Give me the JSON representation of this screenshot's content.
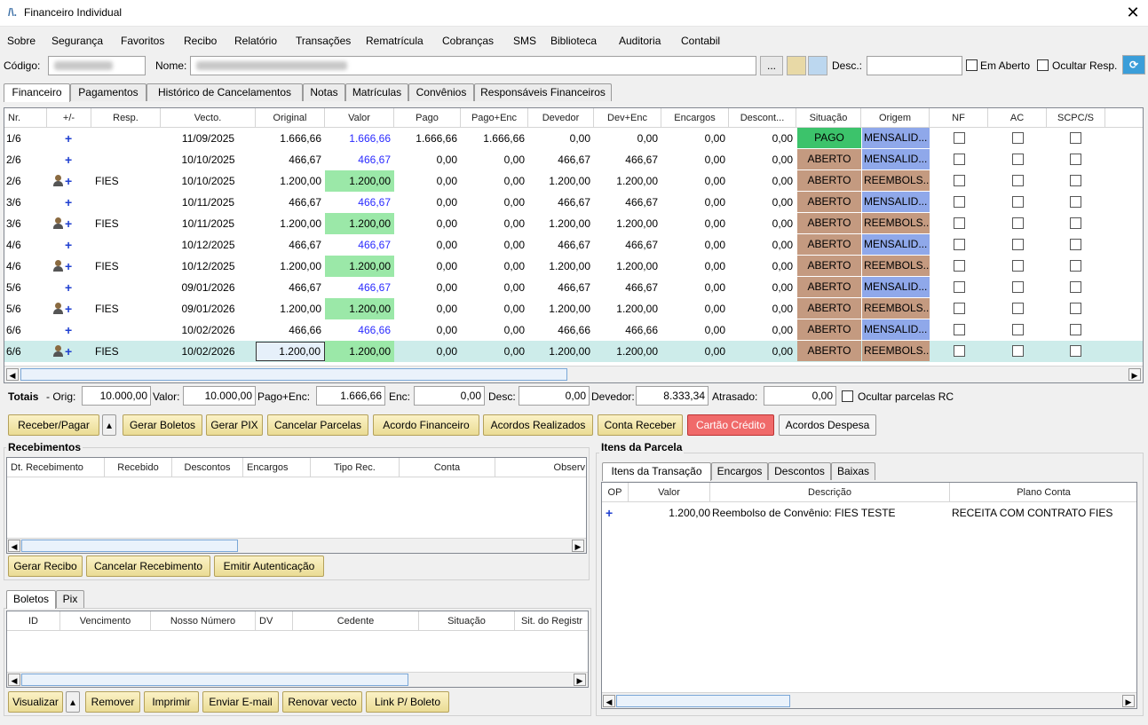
{
  "window": {
    "title": "Financeiro Individual",
    "close": "✕"
  },
  "menu": [
    "Sobre",
    "Segurança",
    "Favoritos",
    "Recibo",
    "Relatório",
    "Transações",
    "Rematrícula",
    "Cobranças",
    "SMS",
    "Biblioteca",
    "Auditoria",
    "Contabil"
  ],
  "filter": {
    "codigo_label": "Código:",
    "nome_label": "Nome:",
    "desc_label": "Desc.:",
    "em_aberto": "Em Aberto",
    "ocultar_resp": "Ocultar Resp.",
    "dots": "..."
  },
  "tabs": [
    "Financeiro",
    "Pagamentos",
    "Histórico de Cancelamentos",
    "Notas",
    "Matrículas",
    "Convênios",
    "Responsáveis Financeiros"
  ],
  "grid": {
    "headers": [
      "Nr.",
      "+/-",
      "Resp.",
      "Vecto.",
      "Original",
      "Valor",
      "Pago",
      "Pago+Enc",
      "Devedor",
      "Dev+Enc",
      "Encargos",
      "Descont...",
      "Situação",
      "Origem",
      "NF",
      "AC",
      "SCPC/S"
    ],
    "rows": [
      {
        "nr": "1/6",
        "resp": "",
        "person": false,
        "vecto": "11/09/2025",
        "original": "1.666,66",
        "valor": "1.666,66",
        "pago": "1.666,66",
        "pagoenc": "1.666,66",
        "devedor": "0,00",
        "devenc": "0,00",
        "encargos": "0,00",
        "desc": "0,00",
        "situacao": "PAGO",
        "origem": "MENSALID..."
      },
      {
        "nr": "2/6",
        "resp": "",
        "person": false,
        "vecto": "10/10/2025",
        "original": "466,67",
        "valor": "466,67",
        "pago": "0,00",
        "pagoenc": "0,00",
        "devedor": "466,67",
        "devenc": "466,67",
        "encargos": "0,00",
        "desc": "0,00",
        "situacao": "ABERTO",
        "origem": "MENSALID..."
      },
      {
        "nr": "2/6",
        "resp": "FIES",
        "person": true,
        "vecto": "10/10/2025",
        "original": "1.200,00",
        "valor": "1.200,00",
        "pago": "0,00",
        "pagoenc": "0,00",
        "devedor": "1.200,00",
        "devenc": "1.200,00",
        "encargos": "0,00",
        "desc": "0,00",
        "situacao": "ABERTO",
        "origem": "REEMBOLS..."
      },
      {
        "nr": "3/6",
        "resp": "",
        "person": false,
        "vecto": "10/11/2025",
        "original": "466,67",
        "valor": "466,67",
        "pago": "0,00",
        "pagoenc": "0,00",
        "devedor": "466,67",
        "devenc": "466,67",
        "encargos": "0,00",
        "desc": "0,00",
        "situacao": "ABERTO",
        "origem": "MENSALID..."
      },
      {
        "nr": "3/6",
        "resp": "FIES",
        "person": true,
        "vecto": "10/11/2025",
        "original": "1.200,00",
        "valor": "1.200,00",
        "pago": "0,00",
        "pagoenc": "0,00",
        "devedor": "1.200,00",
        "devenc": "1.200,00",
        "encargos": "0,00",
        "desc": "0,00",
        "situacao": "ABERTO",
        "origem": "REEMBOLS..."
      },
      {
        "nr": "4/6",
        "resp": "",
        "person": false,
        "vecto": "10/12/2025",
        "original": "466,67",
        "valor": "466,67",
        "pago": "0,00",
        "pagoenc": "0,00",
        "devedor": "466,67",
        "devenc": "466,67",
        "encargos": "0,00",
        "desc": "0,00",
        "situacao": "ABERTO",
        "origem": "MENSALID..."
      },
      {
        "nr": "4/6",
        "resp": "FIES",
        "person": true,
        "vecto": "10/12/2025",
        "original": "1.200,00",
        "valor": "1.200,00",
        "pago": "0,00",
        "pagoenc": "0,00",
        "devedor": "1.200,00",
        "devenc": "1.200,00",
        "encargos": "0,00",
        "desc": "0,00",
        "situacao": "ABERTO",
        "origem": "REEMBOLS..."
      },
      {
        "nr": "5/6",
        "resp": "",
        "person": false,
        "vecto": "09/01/2026",
        "original": "466,67",
        "valor": "466,67",
        "pago": "0,00",
        "pagoenc": "0,00",
        "devedor": "466,67",
        "devenc": "466,67",
        "encargos": "0,00",
        "desc": "0,00",
        "situacao": "ABERTO",
        "origem": "MENSALID..."
      },
      {
        "nr": "5/6",
        "resp": "FIES",
        "person": true,
        "vecto": "09/01/2026",
        "original": "1.200,00",
        "valor": "1.200,00",
        "pago": "0,00",
        "pagoenc": "0,00",
        "devedor": "1.200,00",
        "devenc": "1.200,00",
        "encargos": "0,00",
        "desc": "0,00",
        "situacao": "ABERTO",
        "origem": "REEMBOLS..."
      },
      {
        "nr": "6/6",
        "resp": "",
        "person": false,
        "vecto": "10/02/2026",
        "original": "466,66",
        "valor": "466,66",
        "pago": "0,00",
        "pagoenc": "0,00",
        "devedor": "466,66",
        "devenc": "466,66",
        "encargos": "0,00",
        "desc": "0,00",
        "situacao": "ABERTO",
        "origem": "MENSALID..."
      },
      {
        "nr": "6/6",
        "resp": "FIES",
        "person": true,
        "vecto": "10/02/2026",
        "original": "1.200,00",
        "valor": "1.200,00",
        "pago": "0,00",
        "pagoenc": "0,00",
        "devedor": "1.200,00",
        "devenc": "1.200,00",
        "encargos": "0,00",
        "desc": "0,00",
        "situacao": "ABERTO",
        "origem": "REEMBOLS..."
      }
    ]
  },
  "totals": {
    "prefix": "Totais",
    "orig_label": "- Orig:",
    "orig": "10.000,00",
    "valor_label": "Valor:",
    "valor": "10.000,00",
    "pagoenc_label": "Pago+Enc:",
    "pagoenc": "1.666,66",
    "enc_label": "Enc:",
    "enc": "0,00",
    "desc_label": "Desc:",
    "desc": "0,00",
    "devedor_label": "Devedor:",
    "devedor": "8.333,34",
    "atrasado_label": "Atrasado:",
    "atrasado": "0,00",
    "ocultar_rc": "Ocultar parcelas RC"
  },
  "actions": [
    "Receber/Pagar",
    "Gerar Boletos",
    "Gerar PIX",
    "Cancelar Parcelas",
    "Acordo Financeiro",
    "Acordos Realizados",
    "Conta Receber",
    "Cartão Crédito",
    "Acordos Despesa"
  ],
  "recebimentos": {
    "title": "Recebimentos",
    "headers": [
      "Dt. Recebimento",
      "Recebido",
      "Descontos",
      "Encargos",
      "Tipo Rec.",
      "Conta",
      "Observ"
    ],
    "buttons": [
      "Gerar Recibo",
      "Cancelar Recebimento",
      "Emitir Autenticação"
    ]
  },
  "boletos": {
    "tabs": [
      "Boletos",
      "Pix"
    ],
    "headers": [
      "ID",
      "Vencimento",
      "Nosso Número",
      "DV",
      "Cedente",
      "Situação",
      "Sit. do Registr"
    ],
    "buttons": [
      "Visualizar",
      "Remover",
      "Imprimir",
      "Enviar E-mail",
      "Renovar vecto",
      "Link P/ Boleto"
    ]
  },
  "itens": {
    "title": "Itens da Parcela",
    "tabs": [
      "Itens da Transação",
      "Encargos",
      "Descontos",
      "Baixas"
    ],
    "headers": [
      "OP",
      "Valor",
      "Descrição",
      "Plano Conta"
    ],
    "rows": [
      {
        "op": "+",
        "valor": "1.200,00",
        "descricao": "Reembolso de Convênio: FIES TESTE",
        "plano": "RECEITA COM CONTRATO FIES"
      }
    ]
  },
  "colors": {
    "pago": "#3cc36b",
    "aberto": "#c49a80",
    "mensalidade": "#8fa8ea",
    "reembolso": "#c49a80",
    "valor_green": "#9be8a8",
    "selected_row": "#cdecea",
    "cartao": "#f06a6a"
  }
}
